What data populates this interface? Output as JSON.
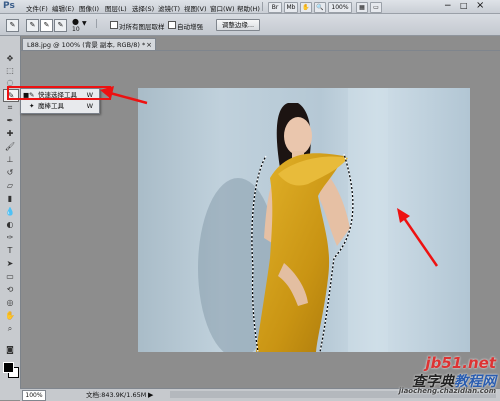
{
  "app": {
    "logo": "Ps"
  },
  "menu": [
    "文件(F)",
    "编辑(E)",
    "图像(I)",
    "图层(L)",
    "选择(S)",
    "滤镜(T)",
    "视图(V)",
    "窗口(W)",
    "帮助(H)"
  ],
  "titlebar": {
    "zoom": "100%",
    "minimize": "−",
    "maximize": "□",
    "close": "×"
  },
  "options": {
    "brush_size": "10",
    "sample_all_layers": "对所有图层取样",
    "auto_enhance": "自动增强",
    "refine_edge": "调整边缘..."
  },
  "document": {
    "tab_title": "L88.jpg @ 100% (背景 副本, RGB/8) *",
    "tab_close": "×"
  },
  "tool_popup": {
    "items": [
      {
        "label": "快速选择工具",
        "key": "W",
        "selected": true
      },
      {
        "label": "魔棒工具",
        "key": "W",
        "selected": false
      }
    ]
  },
  "status": {
    "zoom": "100%",
    "doc_info": "文档:843.9K/1.65M",
    "arrow": "▶"
  },
  "watermarks": {
    "line1": "jb51.net",
    "line2_prefix": "查字典",
    "line2": "教程网",
    "line3": "jiaocheng.chazidian.com"
  },
  "colors": {
    "annotation_red": "#e11111",
    "workspace": "#8d8d8d",
    "dress": "#d4a21a"
  }
}
